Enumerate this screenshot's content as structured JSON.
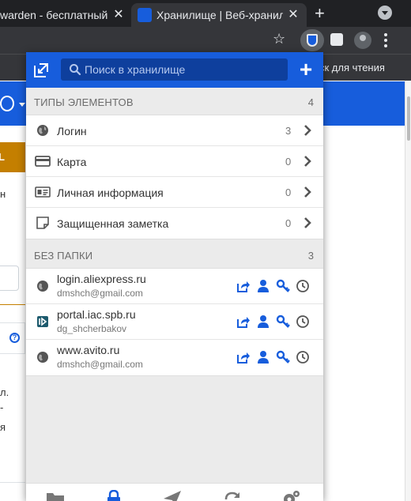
{
  "browser": {
    "tabs": [
      {
        "title": "warden - бесплатный м",
        "active": false
      },
      {
        "title": "Хранилище | Веб-хранил",
        "active": true
      }
    ],
    "bookmarks_bar": {
      "reading_list": "ск для чтения"
    }
  },
  "page_behind": {
    "orange_label": "L",
    "fragments": [
      "н",
      "л.",
      "-",
      "я"
    ]
  },
  "popup": {
    "search": {
      "placeholder": "Поиск в хранилище",
      "value": ""
    },
    "types_section": {
      "title": "Типы элементов",
      "count": "4",
      "items": [
        {
          "label": "Логин",
          "count": "3",
          "icon": "globe-icon"
        },
        {
          "label": "Карта",
          "count": "0",
          "icon": "credit-card-icon"
        },
        {
          "label": "Личная информация",
          "count": "0",
          "icon": "id-card-icon"
        },
        {
          "label": "Защищенная заметка",
          "count": "0",
          "icon": "note-icon"
        }
      ]
    },
    "folder_section": {
      "title": "Без папки",
      "count": "3",
      "items": [
        {
          "name": "login.aliexpress.ru",
          "username": "dmshch@gmail.com",
          "icon": "globe-icon"
        },
        {
          "name": "portal.iac.spb.ru",
          "username": "dg_shcherbakov",
          "icon": "site-favicon-icon"
        },
        {
          "name": "www.avito.ru",
          "username": "dmshch@gmail.com",
          "icon": "globe-icon"
        }
      ]
    },
    "colors": {
      "brand": "#175ddc",
      "background": "#ebebeb"
    }
  }
}
